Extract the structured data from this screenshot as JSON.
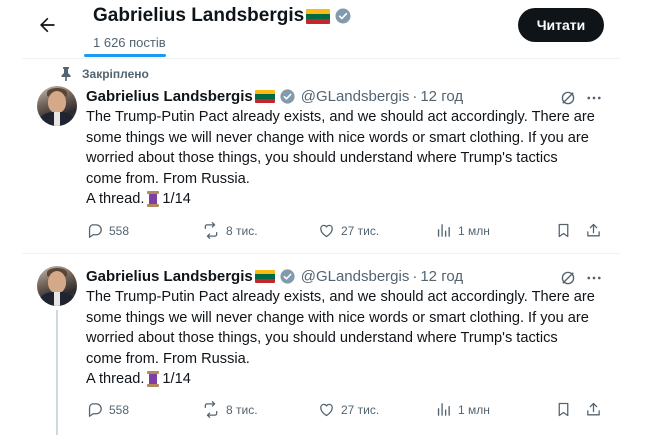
{
  "header": {
    "title": "Gabrielius Landsbergis",
    "post_count": "1 626 постів",
    "follow_label": "Читати"
  },
  "pinned_label": "Закріплено",
  "tweets": [
    {
      "name": "Gabrielius Landsbergis",
      "handle": "@GLandsbergis",
      "separator": "·",
      "time": "12 год",
      "lines": [
        "The Trump-Putin Pact already exists, and we should act accordingly. There are",
        "some things we will never change with nice words or smart clothing. If you are",
        "worried about those things, you should understand where Trump's tactics",
        "come from. From Russia."
      ],
      "thread_prefix": "A thread.",
      "thread_suffix": "1/14",
      "replies": "558",
      "reposts": "8 тис.",
      "likes": "27 тис.",
      "views": "1 млн"
    },
    {
      "name": "Gabrielius Landsbergis",
      "handle": "@GLandsbergis",
      "separator": "·",
      "time": "12 год",
      "lines": [
        "The Trump-Putin Pact already exists, and we should act accordingly. There are",
        "some things we will never change with nice words or smart clothing. If you are",
        "worried about those things, you should understand where Trump's tactics",
        "come from. From Russia."
      ],
      "thread_prefix": "A thread.",
      "thread_suffix": "1/14",
      "replies": "558",
      "reposts": "8 тис.",
      "likes": "27 тис.",
      "views": "1 млн"
    }
  ],
  "icons": {
    "back": "arrow-left-icon",
    "verified": "verified-badge-icon",
    "flag": "lithuania-flag-icon",
    "pin": "pin-icon",
    "grok": "grok-icon",
    "more": "more-icon",
    "reply": "reply-icon",
    "repost": "repost-icon",
    "like": "like-icon",
    "views": "views-icon",
    "bookmark": "bookmark-icon",
    "share": "share-icon",
    "thread_emoji": "spool-emoji-icon"
  },
  "colors": {
    "accent": "#1d9bf0",
    "text": "#0f1419",
    "muted": "#536471",
    "flag_yellow": "#fdb913",
    "flag_green": "#006a44",
    "flag_red": "#c1272d"
  }
}
